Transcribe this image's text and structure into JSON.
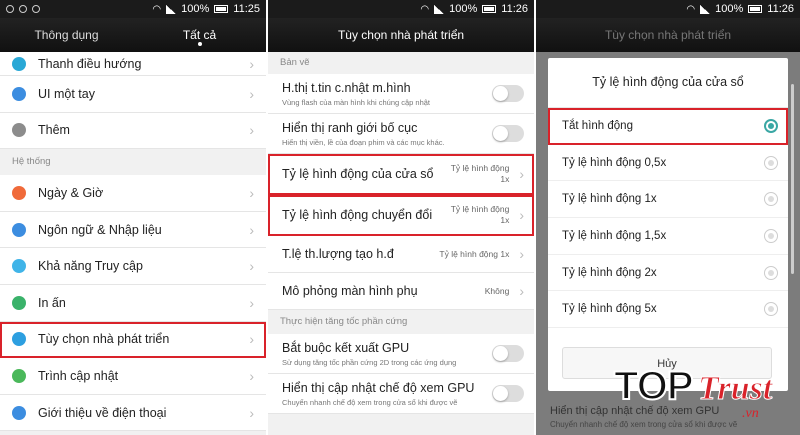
{
  "colors": {
    "highlight": "#d9222a",
    "accent": "#3aa7a4",
    "statusbar": "#1b1b1b"
  },
  "screen1": {
    "status": {
      "battery": "100%",
      "time": "11:25"
    },
    "tabs": [
      {
        "label": "Thông dụng"
      },
      {
        "label": "Tất cả"
      }
    ],
    "items_top": [
      {
        "label": "Thanh điều hướng",
        "icon": "navigation-icon",
        "color": "#29a8d6"
      },
      {
        "label": "UI một tay",
        "icon": "one-hand-icon",
        "color": "#3c8de0"
      },
      {
        "label": "Thêm",
        "icon": "more-icon",
        "color": "#8c8c8c"
      }
    ],
    "section": "Hệ thống",
    "items": [
      {
        "label": "Ngày & Giờ",
        "icon": "clock-icon",
        "color": "#f06a3a"
      },
      {
        "label": "Ngôn ngữ & Nhập liệu",
        "icon": "keyboard-icon",
        "color": "#3c8de0"
      },
      {
        "label": "Khả năng Truy cập",
        "icon": "accessibility-icon",
        "color": "#40b4e8"
      },
      {
        "label": "In ấn",
        "icon": "printer-icon",
        "color": "#3ab26a"
      },
      {
        "label": "Tùy chọn nhà phát triển",
        "icon": "developer-icon",
        "color": "#2d9fe0"
      },
      {
        "label": "Trình cập nhật",
        "icon": "update-icon",
        "color": "#4ab85a"
      },
      {
        "label": "Giới thiệu về điện thoại",
        "icon": "info-icon",
        "color": "#3c8de0"
      }
    ]
  },
  "screen2": {
    "status": {
      "battery": "100%",
      "time": "11:26"
    },
    "title": "Tùy chọn nhà phát triển",
    "section1": "Bản vẽ",
    "rows": [
      {
        "label": "H.thị t.tin c.nhật m.hình",
        "sub": "Vùng flash của màn hình khi chúng cập nhật",
        "type": "toggle"
      },
      {
        "label": "Hiển thị ranh giới bố cục",
        "sub": "Hiển thị viền, lề của đoạn phim và các mục khác.",
        "type": "toggle"
      },
      {
        "label": "Tỷ lệ hình động của cửa sổ",
        "value1": "Tỷ lệ hình động",
        "value2": "1x",
        "type": "value"
      },
      {
        "label": "Tỷ lệ hình động chuyển đổi",
        "value1": "Tỷ lệ hình động",
        "value2": "1x",
        "type": "value"
      },
      {
        "label": "T.lệ th.lượng tạo h.đ",
        "value1": "Tỷ lệ hình động 1x",
        "type": "value"
      },
      {
        "label": "Mô phỏng màn hình phụ",
        "value1": "Không",
        "type": "value"
      }
    ],
    "section2": "Thực hiện tăng tốc phần cứng",
    "rows2": [
      {
        "label": "Bắt buộc kết xuất GPU",
        "sub": "Sử dụng tăng tốc phần cứng 2D trong các ứng dụng"
      },
      {
        "label": "Hiển thị cập nhật chế độ xem GPU",
        "sub": "Chuyển nhanh chế độ xem trong cửa sổ khi được vẽ"
      }
    ]
  },
  "screen3": {
    "status": {
      "battery": "100%",
      "time": "11:26"
    },
    "title": "Tùy chọn nhà phát triển",
    "dialog_title": "Tỷ lệ hình động của cửa sổ",
    "options": [
      {
        "label": "Tắt hình động",
        "selected": true
      },
      {
        "label": "Tỷ lệ hình động 0,5x",
        "selected": false
      },
      {
        "label": "Tỷ lệ hình động 1x",
        "selected": false
      },
      {
        "label": "Tỷ lệ hình động 1,5x",
        "selected": false
      },
      {
        "label": "Tỷ lệ hình động 2x",
        "selected": false
      },
      {
        "label": "Tỷ lệ hình động 5x",
        "selected": false
      }
    ],
    "cancel": "Hủy",
    "bg_row_label": "Hiển thị cập nhật chế độ xem GPU",
    "bg_row_sub": "Chuyển nhanh chế độ xem trong cửa sổ khi được vẽ"
  },
  "watermark": {
    "top": "TOP",
    "trust": "Trust",
    "domain": ".vn"
  }
}
